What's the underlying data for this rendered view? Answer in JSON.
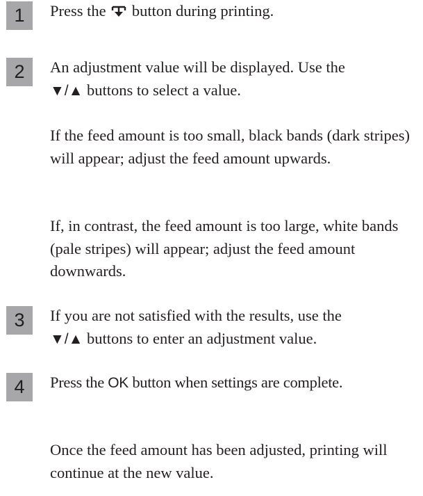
{
  "steps": [
    {
      "number": "1",
      "text_before": "Press the",
      "icon": "paper-feed-icon",
      "text_after": "button during printing."
    },
    {
      "number": "2",
      "line1": "An adjustment value will be displayed. Use the",
      "arrows": "▼/▲",
      "line2_rest": "buttons to select a value.",
      "para2": "If the feed amount is too small, black bands (dark stripes) will appear; adjust the feed amount upwards.",
      "para3": "If, in contrast, the feed amount is too large, white bands (pale stripes) will appear; adjust the feed amount downwards."
    },
    {
      "number": "3",
      "line1": "If you are not satisfied with the results, use the",
      "arrows": "▼/▲",
      "line2_rest": "buttons to enter an adjustment value."
    },
    {
      "number": "4",
      "text_before": "Press the",
      "ok_label": "OK",
      "text_after": "button when settings are complete.",
      "para2": "Once the feed amount has been adjusted, printing will continue at the new value."
    }
  ]
}
